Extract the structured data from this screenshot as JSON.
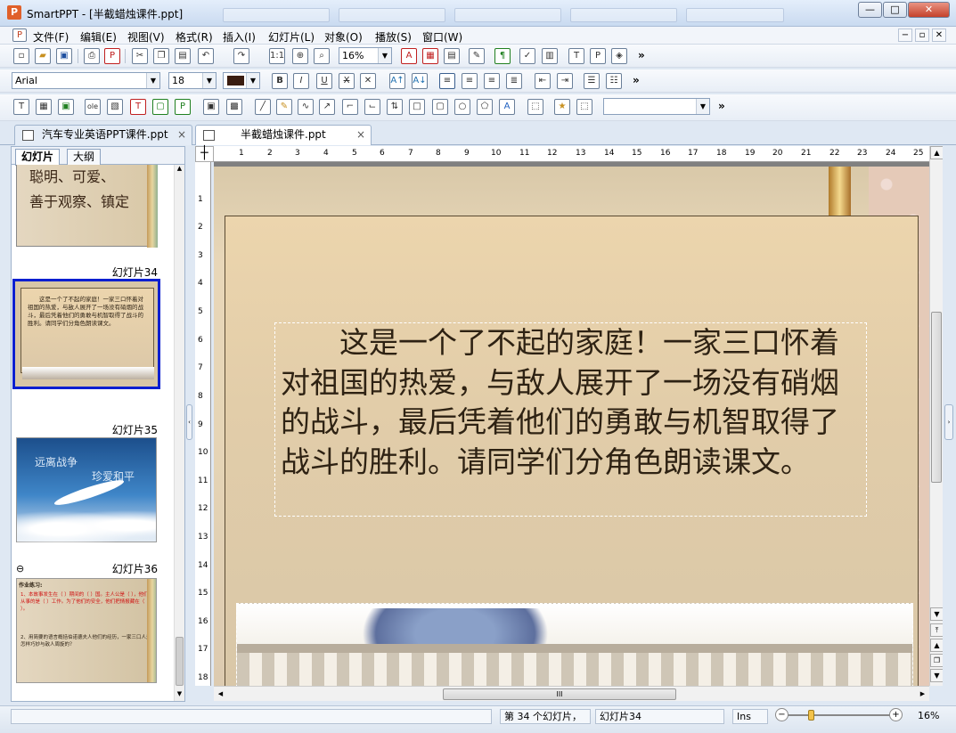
{
  "window": {
    "app_name": "SmartPPT",
    "title": "SmartPPT - [半截蜡烛课件.ppt]",
    "icon_glyph": "P",
    "controls": {
      "minimize": "—",
      "maximize": "□",
      "close": "✕"
    }
  },
  "menu": {
    "items": [
      "文件(F)",
      "编辑(E)",
      "视图(V)",
      "格式(R)",
      "插入(I)",
      "幻灯片(L)",
      "对象(O)",
      "播放(S)",
      "窗口(W)"
    ],
    "mdi": {
      "minimize": "−",
      "restore": "▫",
      "close": "✕"
    }
  },
  "toolbar1": {
    "zoom_value": "16%",
    "more": "»"
  },
  "toolbar2": {
    "font_name": "Arial",
    "font_size": "18",
    "font_color": "#3a1d10",
    "more": "»"
  },
  "toolbar3": {
    "style_value": "",
    "more": "»"
  },
  "doc_tabs": [
    {
      "label": "汽车专业英语PPT课件.ppt",
      "active": false
    },
    {
      "label": "半截蜡烛课件.ppt",
      "active": true
    }
  ],
  "tab_close": "×",
  "pane_tabs": {
    "slides": "幻灯片",
    "outline": "大纲"
  },
  "thumbnails": {
    "partial_text_line1": "聪明、可爱、",
    "partial_text_line2": "善于观察、镇定",
    "s34": {
      "label": "幻灯片34",
      "text": "这是一个了不起的家庭！一家三口怀着对祖国的热爱，与敌人展开了一场没有硝烟的战斗，最后凭着他们的勇敢与机智取得了战斗的胜利。请同学们分角色朗读课文。"
    },
    "s35": {
      "label": "幻灯片35",
      "text1": "远离战争",
      "text2": "珍爱和平"
    },
    "s36": {
      "label": "幻灯片36",
      "heading": "作业练习:",
      "line1": "1、本故事发生在（    ）期间的（    ）国。主人公是（        ），他们从事的是（        ）工作。为了他们的安全，他们把情报藏在（    ）。",
      "line2": "2、用简要的语言概括伯诺德夫人他们的经历，一家三口人是怎样巧妙与敌人周旋的？"
    }
  },
  "ruler": {
    "h": [
      "1",
      "2",
      "3",
      "4",
      "5",
      "6",
      "7",
      "8",
      "9",
      "10",
      "11",
      "12",
      "13",
      "14",
      "15",
      "16",
      "17",
      "18",
      "19",
      "20",
      "21",
      "22",
      "23",
      "24",
      "25"
    ],
    "v": [
      "1",
      "2",
      "3",
      "4",
      "5",
      "6",
      "7",
      "8",
      "9",
      "10",
      "11",
      "12",
      "13",
      "14",
      "15",
      "16",
      "17",
      "18"
    ]
  },
  "slide": {
    "body": "这是一个了不起的家庭！一家三口怀着对祖国的热爱，与敌人展开了一场没有硝烟的战斗，最后凭着他们的勇敢与机智取得了战斗的胜利。请同学们分角色朗读课文。"
  },
  "scroll": {
    "hthumb_grip": "III"
  },
  "status": {
    "slide_count": "第 34 个幻灯片，",
    "slide_name": "幻灯片34",
    "mode": "Ins",
    "zoom": "16%",
    "zoom_minus": "−",
    "zoom_plus": "+"
  }
}
